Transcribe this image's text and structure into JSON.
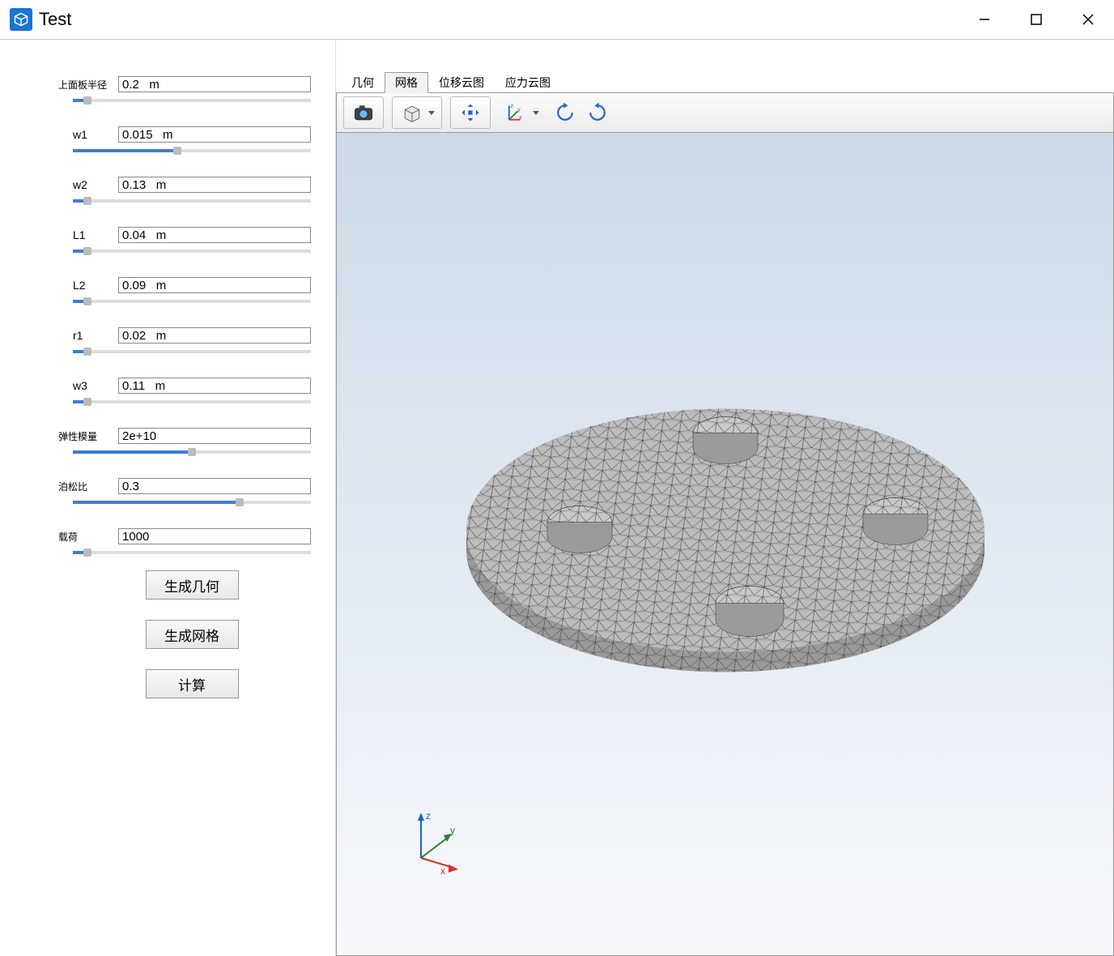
{
  "window": {
    "title": "Test"
  },
  "params": [
    {
      "label": "上面板半径",
      "value": "0.2   m",
      "fill": 6,
      "long": true
    },
    {
      "label": "w1",
      "value": "0.015   m",
      "fill": 44
    },
    {
      "label": "w2",
      "value": "0.13   m",
      "fill": 6
    },
    {
      "label": "L1",
      "value": "0.04   m",
      "fill": 6
    },
    {
      "label": "L2",
      "value": "0.09   m",
      "fill": 6
    },
    {
      "label": "r1",
      "value": "0.02   m",
      "fill": 6
    },
    {
      "label": "w3",
      "value": "0.11   m",
      "fill": 6
    },
    {
      "label": "弹性模量",
      "value": "2e+10",
      "fill": 50,
      "long": true
    },
    {
      "label": "泊松比",
      "value": "0.3",
      "fill": 70,
      "long": true
    },
    {
      "label": "载荷",
      "value": "1000",
      "fill": 6,
      "long": true
    }
  ],
  "buttons": {
    "gen_geometry": "生成几何",
    "gen_mesh": "生成网格",
    "compute": "计算"
  },
  "tabs": [
    {
      "label": "几何",
      "active": false
    },
    {
      "label": "网格",
      "active": true
    },
    {
      "label": "位移云图",
      "active": false
    },
    {
      "label": "应力云图",
      "active": false
    }
  ],
  "toolbar_icons": {
    "camera": "camera-icon",
    "cube": "cube-view-icon",
    "move": "pan-icon",
    "axes": "axes-icon",
    "rot1": "rotate-cw-icon",
    "rot2": "rotate-ccw-icon"
  }
}
